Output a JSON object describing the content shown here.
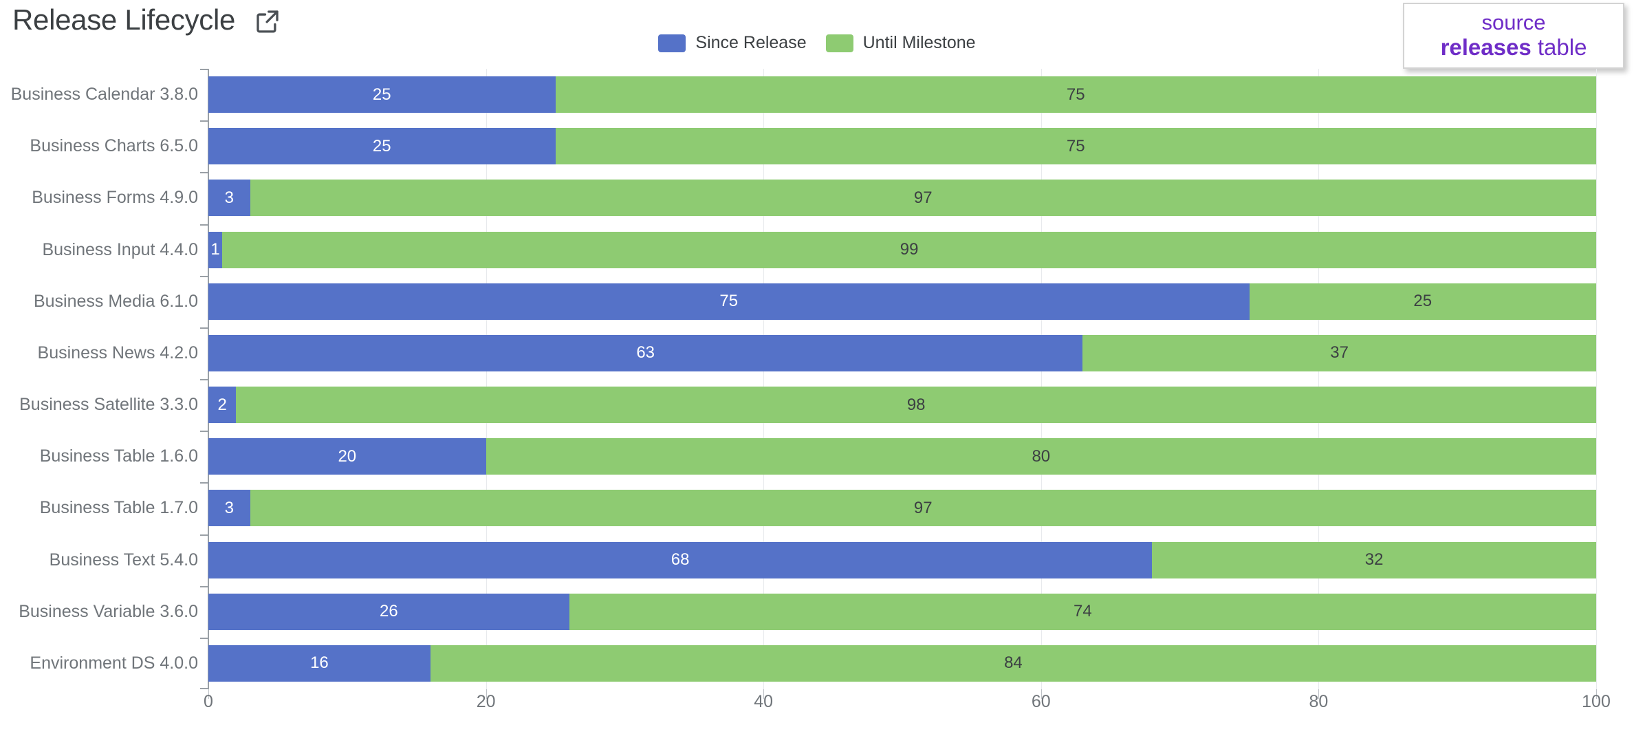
{
  "header": {
    "title": "Release Lifecycle",
    "open_icon": "external-link-icon"
  },
  "source_badge": {
    "line1": "source",
    "line2_bold": "releases",
    "line2_rest": " table",
    "color": "#6f2dc7"
  },
  "legend": {
    "position": "top-center",
    "items": [
      {
        "label": "Since Release",
        "color": "#5572c8"
      },
      {
        "label": "Until Milestone",
        "color": "#8ecb72"
      }
    ]
  },
  "chart_data": {
    "type": "bar",
    "orientation": "horizontal",
    "stacked": true,
    "title": "Release Lifecycle",
    "xlabel": "",
    "ylabel": "",
    "xlim": [
      0,
      100
    ],
    "xticks": [
      0,
      20,
      40,
      60,
      80,
      100
    ],
    "grid": true,
    "categories": [
      "Business Calendar 3.8.0",
      "Business Charts 6.5.0",
      "Business Forms 4.9.0",
      "Business Input 4.4.0",
      "Business Media 6.1.0",
      "Business News 4.2.0",
      "Business Satellite 3.3.0",
      "Business Table 1.6.0",
      "Business Table 1.7.0",
      "Business Text 5.4.0",
      "Business Variable 3.6.0",
      "Environment DS 4.0.0"
    ],
    "series": [
      {
        "name": "Since Release",
        "color": "#5572c8",
        "values": [
          25,
          25,
          3,
          1,
          75,
          63,
          2,
          20,
          3,
          68,
          26,
          16
        ]
      },
      {
        "name": "Until Milestone",
        "color": "#8ecb72",
        "values": [
          75,
          75,
          97,
          99,
          25,
          37,
          98,
          80,
          97,
          32,
          74,
          84
        ]
      }
    ]
  }
}
